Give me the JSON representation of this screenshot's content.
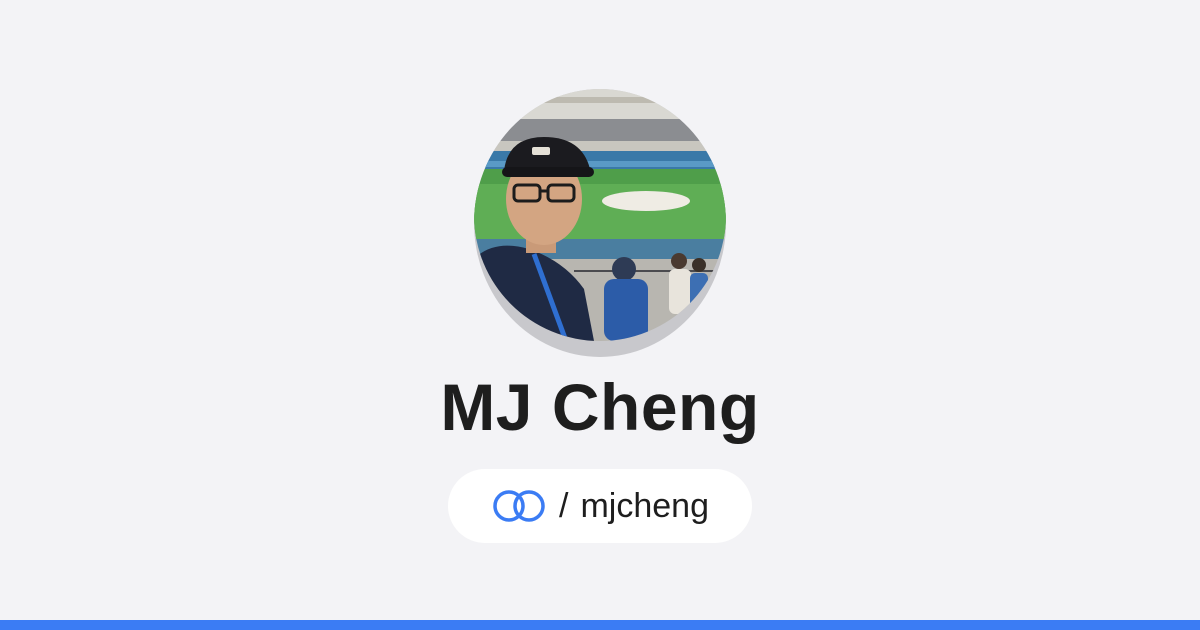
{
  "profile": {
    "name": "MJ Cheng",
    "handle_prefix": "/",
    "handle": "mjcheng",
    "avatar_alt": "Profile photo"
  },
  "colors": {
    "background": "#f3f3f6",
    "accent": "#3b7cf4",
    "text": "#1e1e1e",
    "pill": "#ffffff"
  },
  "icons": {
    "link": "linked-rings-icon"
  }
}
